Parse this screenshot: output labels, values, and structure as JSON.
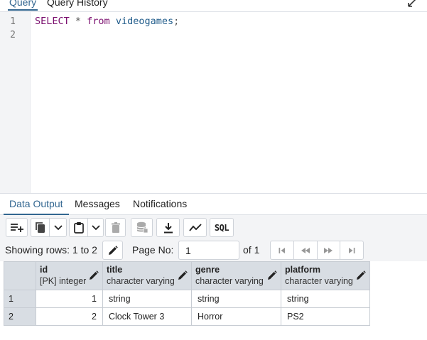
{
  "query_tabs": {
    "query": "Query",
    "history": "Query History"
  },
  "editor": {
    "line_numbers": [
      "1",
      "2"
    ],
    "line1": {
      "kw_select": "SELECT",
      "star": " * ",
      "kw_from": "from",
      "table": " videogames",
      "semi": ";"
    }
  },
  "output_tabs": {
    "data_output": "Data Output",
    "messages": "Messages",
    "notifications": "Notifications"
  },
  "toolbar": {
    "sql_label": "SQL"
  },
  "pager": {
    "showing": "Showing rows: 1 to 2",
    "page_no_label": "Page No:",
    "page_value": "1",
    "of_label": "of 1"
  },
  "grid": {
    "columns": [
      {
        "name": "id",
        "type": "[PK] integer"
      },
      {
        "name": "title",
        "type": "character varying"
      },
      {
        "name": "genre",
        "type": "character varying"
      },
      {
        "name": "platform",
        "type": "character varying"
      }
    ],
    "rows": [
      {
        "num": "1",
        "cells": [
          "1",
          "string",
          "string",
          "string"
        ]
      },
      {
        "num": "2",
        "cells": [
          "2",
          "Clock Tower 3",
          "Horror",
          "PS2"
        ]
      }
    ]
  },
  "colors": {
    "accent": "#326690",
    "keyword": "#7a0e6e",
    "identifier": "#1f5b8a",
    "header_bg": "#d8dde3",
    "toolbar_bg": "#f3f4f6"
  }
}
